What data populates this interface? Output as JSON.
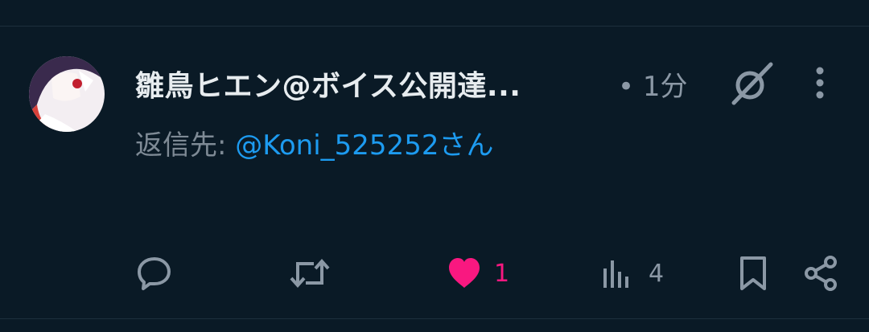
{
  "post": {
    "author_name": "雛鳥ヒエン@ボイス公開達...",
    "time": "• 1分",
    "reply_prefix": "返信先: ",
    "reply_mention": "@Koni_525252さん"
  },
  "actions": {
    "reply_icon": "reply-icon",
    "retweet_icon": "retweet-icon",
    "like_icon": "heart-icon",
    "like_count": "1",
    "views_icon": "views-icon",
    "views_count": "4",
    "bookmark_icon": "bookmark-icon",
    "share_icon": "share-icon"
  },
  "colors": {
    "background": "#0a1a26",
    "text_primary": "#e7ecef",
    "text_secondary": "#8b98a5",
    "accent_blue": "#1d9bf0",
    "like_pink": "#f91880"
  }
}
